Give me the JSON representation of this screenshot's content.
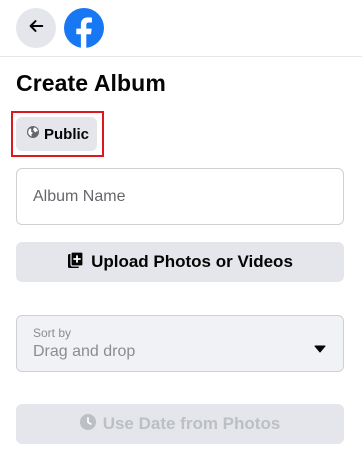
{
  "header": {
    "back_icon": "arrow-left-icon",
    "logo": "facebook-logo",
    "brand_color": "#1877f2"
  },
  "page": {
    "title": "Create Album"
  },
  "privacy": {
    "label": "Public",
    "icon": "globe-icon",
    "highlight_color": "#e0161e"
  },
  "album_name": {
    "placeholder": "Album Name",
    "value": ""
  },
  "upload": {
    "label": "Upload Photos or Videos",
    "icon": "add-photo-icon"
  },
  "sort": {
    "caption": "Sort by",
    "value": "Drag and drop",
    "icon": "caret-down-icon"
  },
  "date_button": {
    "label": "Use Date from Photos",
    "icon": "clock-icon",
    "disabled": true
  }
}
